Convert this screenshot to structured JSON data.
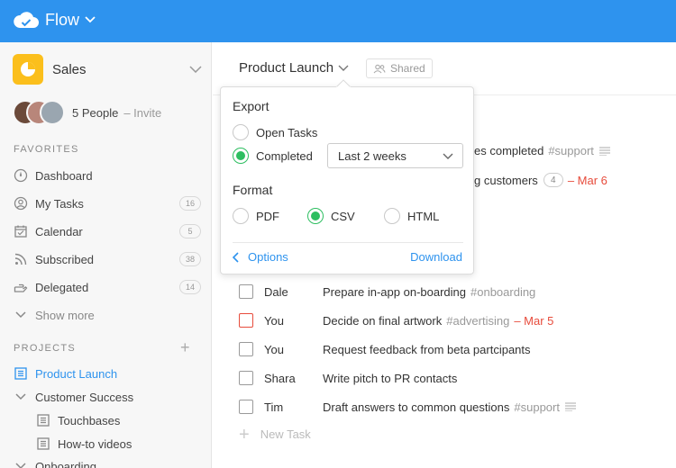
{
  "app": {
    "name": "Flow"
  },
  "sidebar": {
    "workspace": "Sales",
    "people": {
      "count_label": "5 People",
      "invite_label": "– Invite"
    },
    "favorites_heading": "FAVORITES",
    "favorites": [
      {
        "label": "Dashboard",
        "icon": "dashboard-icon"
      },
      {
        "label": "My Tasks",
        "icon": "user-icon",
        "count": "16"
      },
      {
        "label": "Calendar",
        "icon": "calendar-icon",
        "count": "5"
      },
      {
        "label": "Subscribed",
        "icon": "rss-icon",
        "count": "38"
      },
      {
        "label": "Delegated",
        "icon": "delegate-hand-icon",
        "count": "14"
      }
    ],
    "show_more": "Show more",
    "projects_heading": "PROJECTS",
    "projects": [
      {
        "label": "Product Launch",
        "active": true
      },
      {
        "label": "Customer Success"
      },
      {
        "label": "Touchbases"
      },
      {
        "label": "How-to videos"
      },
      {
        "label": "Onboarding"
      }
    ]
  },
  "main": {
    "project_title": "Product Launch",
    "shared_label": "Shared",
    "partial_rows": [
      {
        "text": "es completed",
        "tag": "#support"
      },
      {
        "text": "g customers",
        "comments": "4",
        "due": "– Mar 6"
      }
    ],
    "tasks": [
      {
        "assignee": "Dale",
        "title": "Prepare in-app on-boarding",
        "tag": "#onboarding"
      },
      {
        "assignee": "You",
        "title": "Decide on final artwork",
        "tag": "#advertising",
        "due": "– Mar 5",
        "overdue": true
      },
      {
        "assignee": "You",
        "title": "Request feedback from beta partcipants"
      },
      {
        "assignee": "Shara",
        "title": "Write pitch to PR contacts"
      },
      {
        "assignee": "Tim",
        "title": "Draft answers to common questions",
        "tag": "#support",
        "has_note": true
      }
    ],
    "new_task": "New Task"
  },
  "popup": {
    "export_heading": "Export",
    "open_tasks": "Open Tasks",
    "completed": "Completed",
    "range": "Last 2 weeks",
    "format_heading": "Format",
    "formats": [
      "PDF",
      "CSV",
      "HTML"
    ],
    "selected_format": "CSV",
    "options": "Options",
    "download": "Download"
  },
  "colors": {
    "topbar": "#2e93ee",
    "accent_green": "#2dbe60",
    "due_red": "#e74c3c",
    "workspace_badge": "#fbbf1c"
  }
}
